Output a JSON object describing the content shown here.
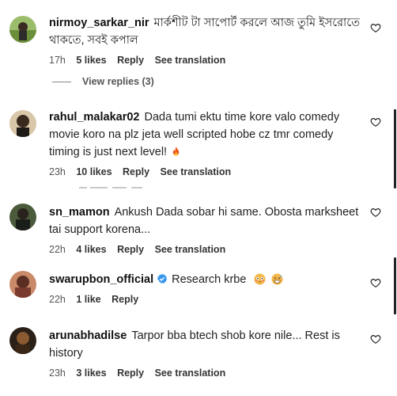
{
  "comments": [
    {
      "username": "nirmoy_sarkar_nir",
      "text": "মার্কশীট টা সাপোর্ট করলে আজ তুমি ইসরোতে থাকতে, সবই কপাল",
      "time": "17h",
      "likes": "5 likes",
      "reply": "Reply",
      "translate": "See translation",
      "avatar_color": "#6b8e3a"
    },
    {
      "username": "rahul_malakar02",
      "text": "Dada tumi ektu time kore valo comedy movie koro na plz jeta well scripted hobe cz tmr comedy timing is just next level!",
      "emoji": "fire",
      "time": "23h",
      "likes": "10 likes",
      "reply": "Reply",
      "translate": "See translation",
      "avatar_color": "#3a2a1e"
    },
    {
      "username": "sn_mamon",
      "text": "Ankush Dada sobar hi same. Obosta marksheet tai support korena...",
      "time": "22h",
      "likes": "4 likes",
      "reply": "Reply",
      "translate": "See translation",
      "avatar_color": "#2f3a2a"
    },
    {
      "username": "swarupbon_official",
      "text": "Research krbe",
      "emoji": "flushed, grin-sweat",
      "verified": true,
      "time": "22h",
      "likes": "1 like",
      "reply": "Reply",
      "avatar_color": "#7a3b2e"
    },
    {
      "username": "arunabhadilse",
      "text": "Tarpor bba btech shob kore nile... Rest is history",
      "time": "23h",
      "likes": "3 likes",
      "reply": "Reply",
      "translate": "See translation",
      "avatar_color": "#5a3a20"
    }
  ],
  "view_replies": "View replies (3)",
  "icons": {
    "like": "heart-outline-icon",
    "verified": "verified-badge-icon"
  },
  "colors": {
    "verified": "#3897f0",
    "text": "#222222",
    "muted": "#555555"
  }
}
